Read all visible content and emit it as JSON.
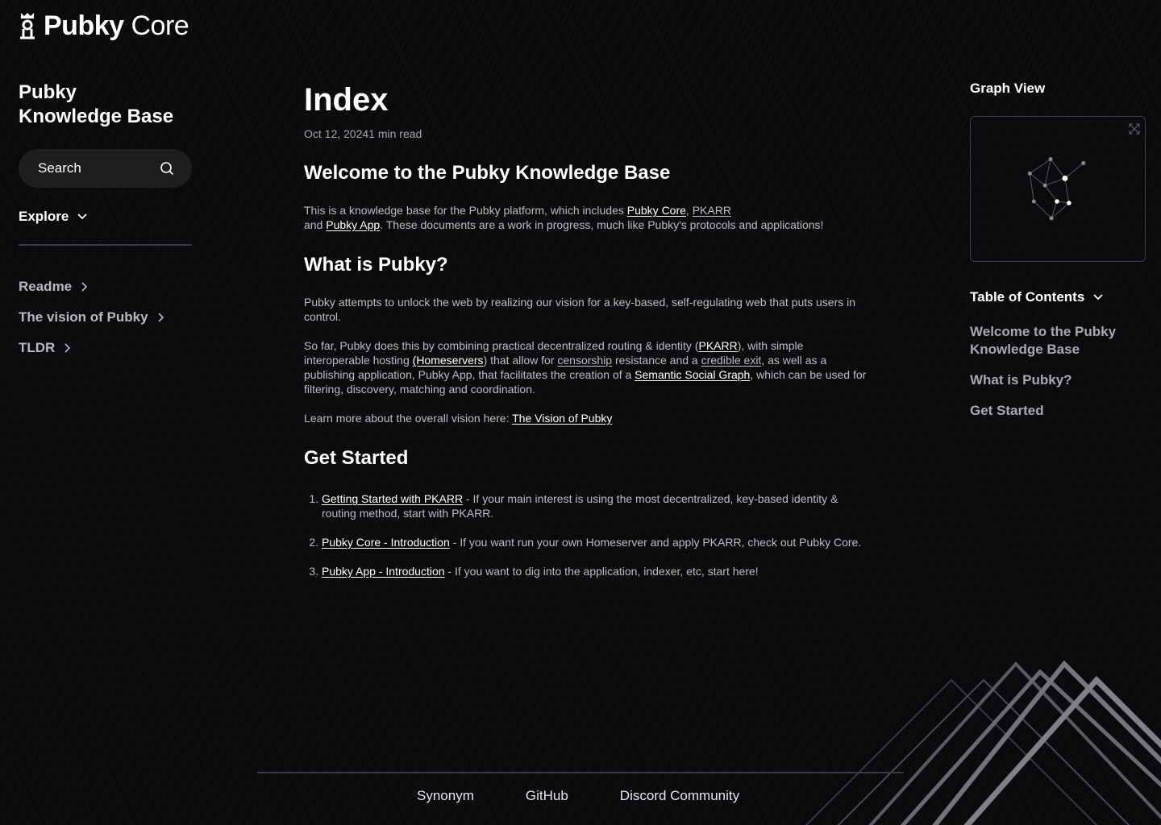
{
  "brand": {
    "bold": "Pubky",
    "light": "Core"
  },
  "sidebar": {
    "title_line1": "Pubky",
    "title_line2": "Knowledge Base",
    "search_label": "Search",
    "explore_label": "Explore",
    "nav": [
      {
        "label": "Readme"
      },
      {
        "label": "The vision of Pubky"
      },
      {
        "label": "TLDR"
      }
    ]
  },
  "main": {
    "title": "Index",
    "meta": "Oct 12, 20241 min read",
    "welcome_heading": "Welcome to the Pubky Knowledge Base",
    "intro": {
      "t1": "This is a knowledge base for the Pubky platform, which includes ",
      "l1": "Pubky Core",
      "t2": ", ",
      "l2": "PKARR",
      "t3": " and ",
      "l3": "Pubky App",
      "t4": ". These documents are a work in progress, much like Pubky's protocols and applications!"
    },
    "what_heading": "What is Pubky?",
    "what_p1": "Pubky attempts to unlock the web by realizing our vision for a key-based, self-regulating web that puts users in control.",
    "what_p2": {
      "t1": "So far, Pubky does this by combining practical decentralized routing & identity (",
      "l1": "PKARR",
      "t2": "), with simple interoperable hosting ",
      "l2": "(Homeservers",
      "t3": ") that allow for ",
      "l3": "censorship",
      "t4": " resistance and a ",
      "l4": "credible exit",
      "t5": ", as well as a publishing application, Pubky App, that facilitates the creation of a ",
      "l5": "Semantic Social Graph",
      "t6": ", which can be used for filtering, discovery, matching and coordination."
    },
    "what_p3": {
      "t1": "Learn more about the overall vision here: ",
      "l1": "The Vision of Pubky"
    },
    "start_heading": "Get Started",
    "steps": [
      {
        "link": "Getting Started with PKARR",
        "text": " - If your main interest is using the most decentralized, key-based identity & routing method, start with PKARR."
      },
      {
        "link": "Pubky Core - Introduction",
        "text": " - If you want run your own Homeserver and apply PKARR, check out Pubky Core."
      },
      {
        "link": "Pubky App - Introduction",
        "text": " - If you want to dig into the application, indexer, etc, start here!"
      }
    ]
  },
  "right": {
    "graph_title": "Graph View",
    "toc_title": "Table of Contents",
    "toc": [
      {
        "label": "Welcome to the Pubky Knowledge Base"
      },
      {
        "label": "What is Pubky?"
      },
      {
        "label": "Get Started"
      }
    ]
  },
  "footer": {
    "links": [
      {
        "label": "Synonym"
      },
      {
        "label": "GitHub"
      },
      {
        "label": "Discord Community"
      }
    ]
  },
  "icons": {
    "logo": "pubky-logo-icon",
    "search": "search-icon",
    "explore": "chevron-down-icon",
    "nav": "chevron-right-icon",
    "graph_expand": "expand-icon",
    "toc": "chevron-down-icon"
  },
  "colors": {
    "background": "#0b0b0d",
    "text": "#ffffff",
    "muted_text": "#bdbdc1",
    "search_bg": "#1e1e21",
    "border": "#3d3d42"
  }
}
